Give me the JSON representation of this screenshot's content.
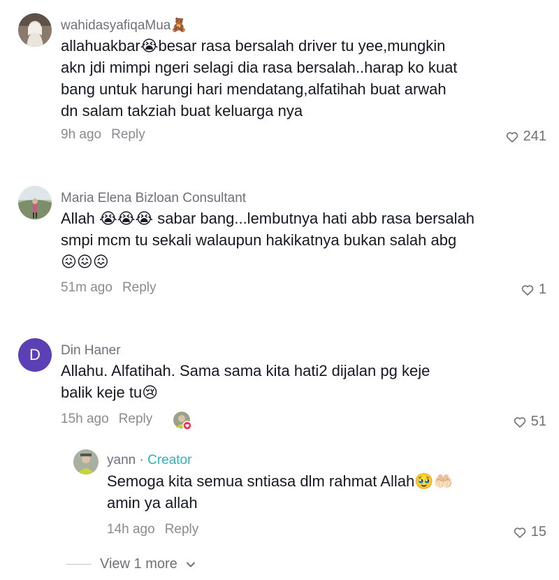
{
  "comments": [
    {
      "username": "wahidasyafiqaMua",
      "username_emoji": "🧸",
      "text_lines": [
        "allahuakbar😭besar rasa bersalah driver tu yee,mungkin",
        "akn jdi mimpi ngeri selagi dia rasa bersalah..harap ko kuat",
        "bang untuk harungi hari mendatang,alfatihah buat arwah",
        "dn salam takziah buat keluarga nya"
      ],
      "time": "9h ago",
      "reply_label": "Reply",
      "likes": "241"
    },
    {
      "username": "Maria Elena Bizloan Consultant",
      "text_lines": [
        "Allah 😭😭😭 sabar bang...lembutnya hati abb rasa bersalah",
        "smpi mcm tu sekali walaupun hakikatnya bukan salah abg",
        "😖😖😖"
      ],
      "time": "51m ago",
      "reply_label": "Reply",
      "likes": "1"
    },
    {
      "username": "Din Haner",
      "avatar_letter": "D",
      "text_lines": [
        "Allahu. Alfatihah. Sama sama kita hati2 dijalan pg keje",
        "balik keje tu😢"
      ],
      "time": "15h ago",
      "reply_label": "Reply",
      "likes": "51"
    }
  ],
  "reply": {
    "username": "yann",
    "separator": " · ",
    "creator_label": "Creator",
    "text_lines": [
      "Semoga kita semua sntiasa dlm rahmat Allah🥹🤲🏻",
      "amin ya allah"
    ],
    "time": "14h ago",
    "reply_label": "Reply",
    "likes": "15"
  },
  "view_more_label": "View 1 more",
  "colors": {
    "creator": "#2bb3c0",
    "avatar_d": "#5a3fb5",
    "liked_badge": "#fe2c55"
  }
}
